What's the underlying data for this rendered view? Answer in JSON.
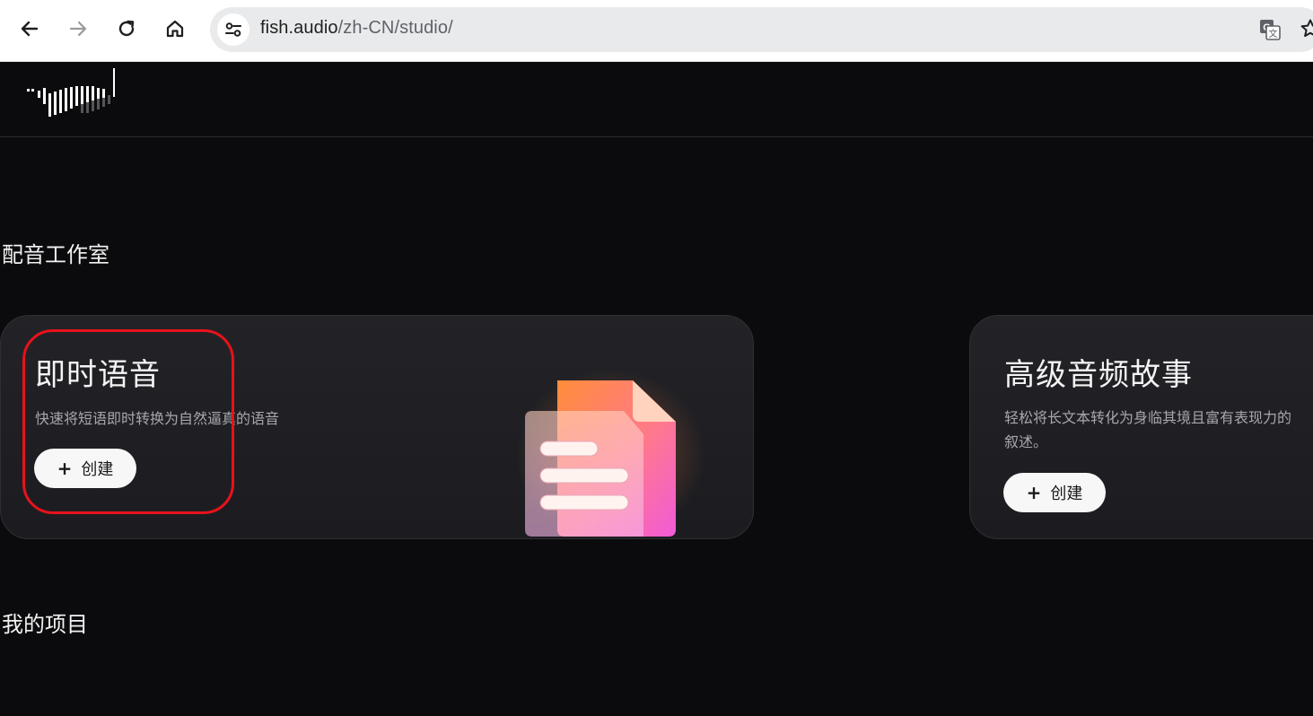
{
  "browser": {
    "url_host": "fish.audio",
    "url_path": "/zh-CN/studio/"
  },
  "page": {
    "studio_title": "配音工作室",
    "projects_title": "我的项目"
  },
  "cards": [
    {
      "title": "即时语音",
      "description": "快速将短语即时转换为自然逼真的语音",
      "button_label": "创建"
    },
    {
      "title": "高级音频故事",
      "description": "轻松将长文本转化为身临其境且富有表现力的",
      "description_line2": "叙述。",
      "button_label": "创建"
    }
  ],
  "colors": {
    "background": "#0b0b0d",
    "card": "#222226",
    "button": "#f7f7f8",
    "annotation": "#e8121b"
  }
}
